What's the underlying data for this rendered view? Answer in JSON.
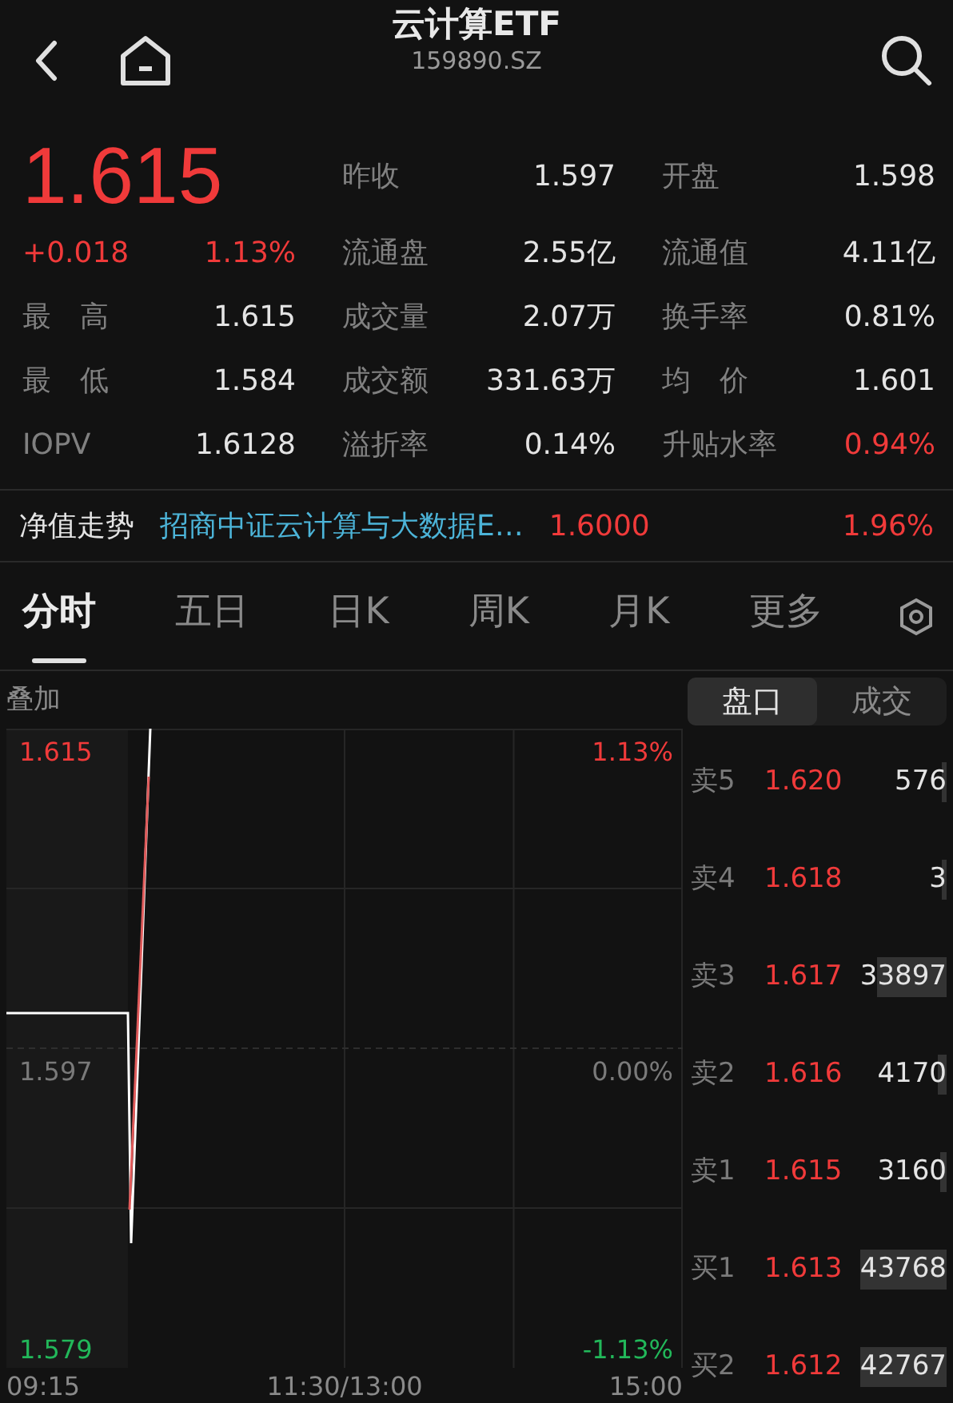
{
  "header": {
    "title": "云计算ETF",
    "code": "159890.SZ"
  },
  "quote": {
    "price": "1.615",
    "change": "+0.018",
    "change_pct": "1.13%"
  },
  "stats": [
    {
      "label": "昨收",
      "value": "1.597",
      "color": "#e4e4e4"
    },
    {
      "label": "开盘",
      "value": "1.598",
      "color": "#e4e4e4"
    },
    {
      "label": "流通盘",
      "value": "2.55亿",
      "color": "#e4e4e4"
    },
    {
      "label": "流通值",
      "value": "4.11亿",
      "color": "#e4e4e4"
    },
    {
      "label": "最　高",
      "value": "1.615",
      "color": "#e4e4e4"
    },
    {
      "label": "成交量",
      "value": "2.07万",
      "color": "#e4e4e4"
    },
    {
      "label": "换手率",
      "value": "0.81%",
      "color": "#e4e4e4"
    },
    {
      "label": "最　低",
      "value": "1.584",
      "color": "#e4e4e4"
    },
    {
      "label": "成交额",
      "value": "331.63万",
      "color": "#e4e4e4"
    },
    {
      "label": "均　价",
      "value": "1.601",
      "color": "#e4e4e4"
    },
    {
      "label": "IOPV",
      "value": "1.6128",
      "color": "#e4e4e4"
    },
    {
      "label": "溢折率",
      "value": "0.14%",
      "color": "#e4e4e4"
    },
    {
      "label": "升贴水率",
      "value": "0.94%",
      "color": "#f03a3a"
    }
  ],
  "nav": {
    "label": "净值走势",
    "fund": "招商中证云计算与大数据E…",
    "value": "1.6000",
    "pct": "1.96%"
  },
  "tabs": [
    {
      "label": "分时",
      "selected": true
    },
    {
      "label": "五日",
      "selected": false
    },
    {
      "label": "日K",
      "selected": false
    },
    {
      "label": "周K",
      "selected": false
    },
    {
      "label": "月K",
      "selected": false
    },
    {
      "label": "更多",
      "selected": false
    }
  ],
  "overlay_label": "叠加",
  "chart": {
    "price_labels": [
      {
        "text": "1.615",
        "color": "#f03a3a"
      },
      {
        "text": "1.597",
        "color": "#7a7a7a"
      },
      {
        "text": "1.579",
        "color": "#22b85a"
      }
    ],
    "percent_labels": [
      {
        "text": "1.13%",
        "color": "#f03a3a"
      },
      {
        "text": "0.00%",
        "color": "#7a7a7a"
      },
      {
        "text": "-1.13%",
        "color": "#22b85a"
      }
    ],
    "time_labels": [
      "09:15",
      "11:30/13:00",
      "15:00"
    ]
  },
  "book_tabs": [
    {
      "label": "盘口",
      "selected": true
    },
    {
      "label": "成交",
      "selected": false
    }
  ],
  "order_book": [
    {
      "label": "卖5",
      "price": "1.620",
      "volume": "576"
    },
    {
      "label": "卖4",
      "price": "1.618",
      "volume": "3"
    },
    {
      "label": "卖3",
      "price": "1.617",
      "volume": "33897"
    },
    {
      "label": "卖2",
      "price": "1.616",
      "volume": "4170"
    },
    {
      "label": "卖1",
      "price": "1.615",
      "volume": "3160"
    },
    {
      "label": "买1",
      "price": "1.613",
      "volume": "43768"
    },
    {
      "label": "买2",
      "price": "1.612",
      "volume": "42767"
    }
  ]
}
